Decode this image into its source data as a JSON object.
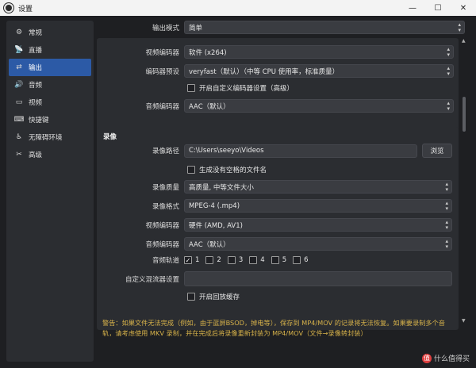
{
  "window": {
    "title": "设置",
    "minimize": "—",
    "maximize": "☐",
    "close": "✕"
  },
  "sidebar": {
    "items": [
      {
        "label": "常规",
        "icon": "⚙"
      },
      {
        "label": "直播",
        "icon": "📡"
      },
      {
        "label": "输出",
        "icon": "⇄"
      },
      {
        "label": "音频",
        "icon": "🔊"
      },
      {
        "label": "视频",
        "icon": "▭"
      },
      {
        "label": "快捷键",
        "icon": "⌨"
      },
      {
        "label": "无障碍环境",
        "icon": "♿"
      },
      {
        "label": "高级",
        "icon": "✂"
      }
    ]
  },
  "output_mode": {
    "label": "输出模式",
    "value": "简单"
  },
  "streaming": {
    "video_encoder": {
      "label": "视频编码器",
      "value": "软件 (x264)"
    },
    "encoder_preset": {
      "label": "编码器预设",
      "value": "veryfast（默认）（中等 CPU 使用率，标准质量）"
    },
    "custom_encoder": {
      "label": "开启自定义编码器设置（高级）"
    },
    "audio_encoder": {
      "label": "音频编码器",
      "value": "AAC（默认）"
    }
  },
  "recording": {
    "title": "录像",
    "path": {
      "label": "录像路径",
      "value": "C:\\Users\\seeyo\\Videos",
      "browse": "浏览"
    },
    "no_space": {
      "label": "生成没有空格的文件名"
    },
    "quality": {
      "label": "录像质量",
      "value": "高质量, 中等文件大小"
    },
    "format": {
      "label": "录像格式",
      "value": "MPEG-4 (.mp4)"
    },
    "video_encoder": {
      "label": "视频编码器",
      "value": "硬件 (AMD, AV1)"
    },
    "audio_encoder": {
      "label": "音频编码器",
      "value": "AAC（默认）"
    },
    "tracks": {
      "label": "音频轨道",
      "items": [
        "1",
        "2",
        "3",
        "4",
        "5",
        "6"
      ],
      "checked": [
        "✓",
        "",
        "",
        "",
        "",
        ""
      ]
    },
    "muxer": {
      "label": "自定义混流器设置",
      "value": ""
    },
    "replay_buffer": {
      "label": "开启回放缓存"
    }
  },
  "warning": {
    "line1": "警告：如果文件无法完成（例如，由于蓝屏BSOD，掉电等），保存到 MP4/MOV 的记录将无法恢复。如果要录制多个音",
    "line2": "轨，请考虑使用 MKV 录制，并在完成后将录像重新封装为 MP4/MOV（文件→录像转封装）"
  },
  "watermark": {
    "icon": "值",
    "text": "什么值得买"
  }
}
